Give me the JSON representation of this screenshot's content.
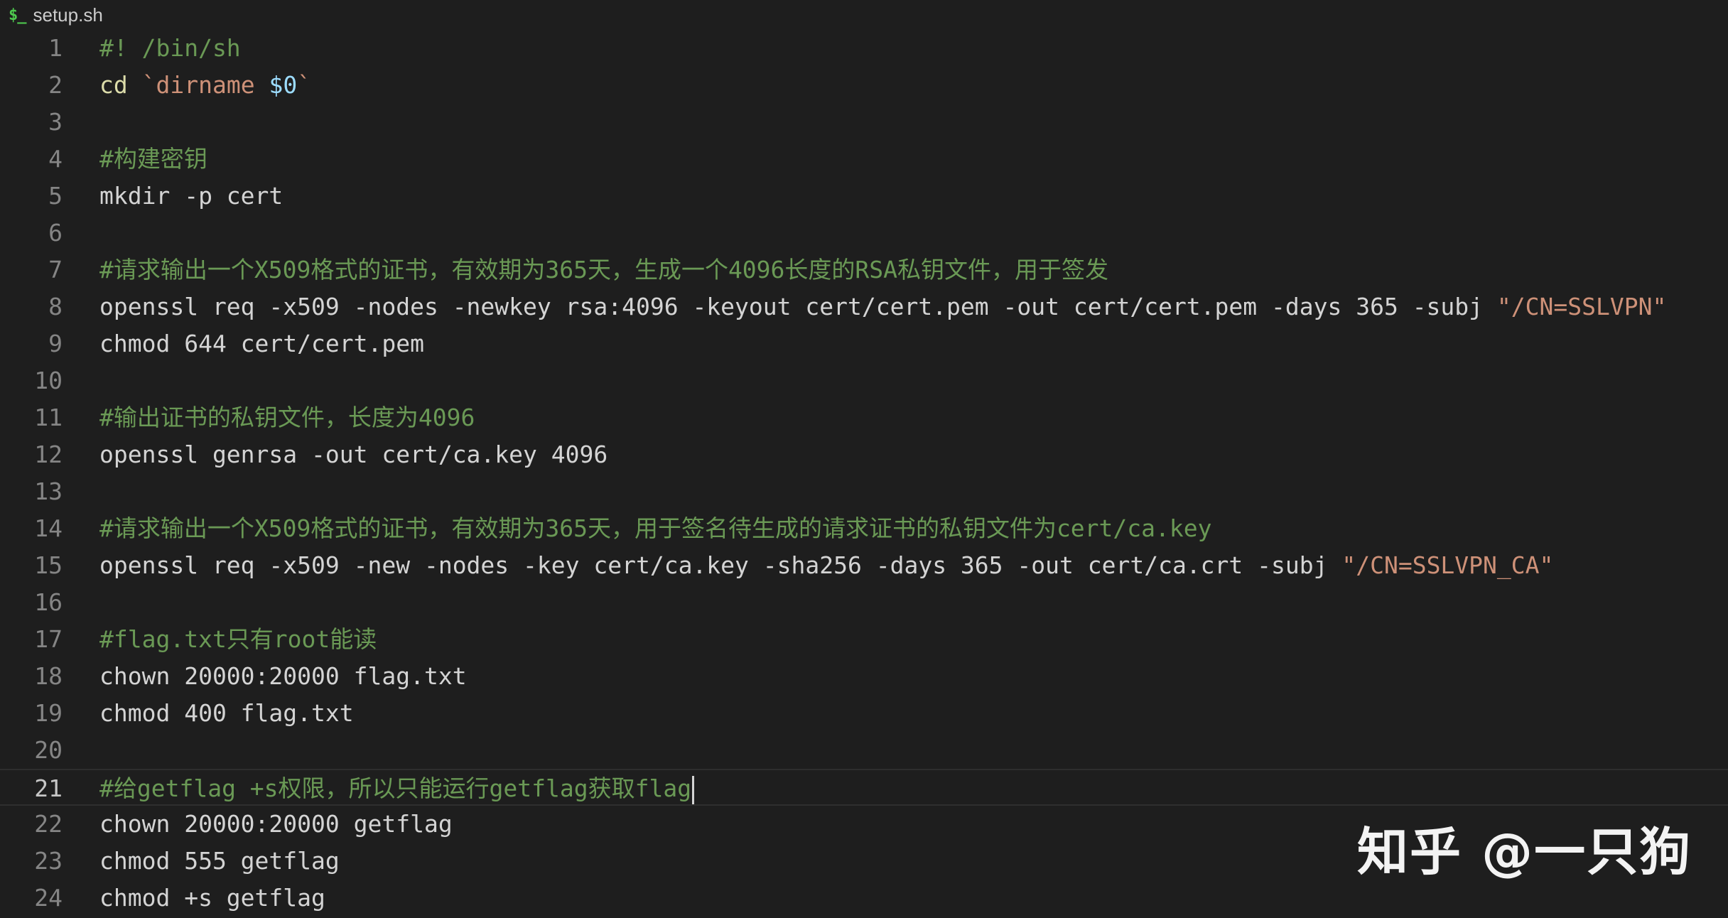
{
  "tab": {
    "icon": "$_",
    "icon_name": "terminal-shell-icon",
    "filename": "setup.sh"
  },
  "colors": {
    "background": "#1e1e1e",
    "comment": "#6a9955",
    "builtin": "#dcdcaa",
    "string": "#ce9178",
    "variable": "#9cdcfe",
    "text": "#d4d4d4",
    "line_number": "#858585"
  },
  "editor": {
    "current_line": 21,
    "lines": [
      {
        "n": "1",
        "tokens": [
          {
            "t": "#! /bin/sh",
            "c": "comment"
          }
        ]
      },
      {
        "n": "2",
        "tokens": [
          {
            "t": "cd",
            "c": "builtin"
          },
          {
            "t": " `",
            "c": "string"
          },
          {
            "t": "dirname",
            "c": "string"
          },
          {
            "t": " ",
            "c": "plain"
          },
          {
            "t": "$0",
            "c": "variable"
          },
          {
            "t": "`",
            "c": "string"
          }
        ]
      },
      {
        "n": "3",
        "tokens": []
      },
      {
        "n": "4",
        "tokens": [
          {
            "t": "#构建密钥",
            "c": "comment"
          }
        ]
      },
      {
        "n": "5",
        "tokens": [
          {
            "t": "mkdir -p cert",
            "c": "plain"
          }
        ]
      },
      {
        "n": "6",
        "tokens": []
      },
      {
        "n": "7",
        "tokens": [
          {
            "t": "#请求输出一个X509格式的证书，有效期为365天，生成一个4096长度的RSA私钥文件，用于签发",
            "c": "comment"
          }
        ]
      },
      {
        "n": "8",
        "tokens": [
          {
            "t": "openssl req -x509 -nodes -newkey rsa:4096 -keyout cert/cert.pem -out cert/cert.pem -days 365 -subj ",
            "c": "plain"
          },
          {
            "t": "\"/CN=SSLVPN\"",
            "c": "string"
          }
        ]
      },
      {
        "n": "9",
        "tokens": [
          {
            "t": "chmod 644 cert/cert.pem",
            "c": "plain"
          }
        ]
      },
      {
        "n": "10",
        "tokens": []
      },
      {
        "n": "11",
        "tokens": [
          {
            "t": "#输出证书的私钥文件，长度为4096",
            "c": "comment"
          }
        ]
      },
      {
        "n": "12",
        "tokens": [
          {
            "t": "openssl genrsa -out cert/ca.key 4096",
            "c": "plain"
          }
        ]
      },
      {
        "n": "13",
        "tokens": []
      },
      {
        "n": "14",
        "tokens": [
          {
            "t": "#请求输出一个X509格式的证书，有效期为365天，用于签名待生成的请求证书的私钥文件为cert/ca.key",
            "c": "comment"
          }
        ]
      },
      {
        "n": "15",
        "tokens": [
          {
            "t": "openssl req -x509 -new -nodes -key cert/ca.key -sha256 -days 365 -out cert/ca.crt -subj ",
            "c": "plain"
          },
          {
            "t": "\"/CN=SSLVPN_CA\"",
            "c": "string"
          }
        ]
      },
      {
        "n": "16",
        "tokens": []
      },
      {
        "n": "17",
        "tokens": [
          {
            "t": "#flag.txt只有root能读",
            "c": "comment"
          }
        ]
      },
      {
        "n": "18",
        "tokens": [
          {
            "t": "chown 20000:20000 flag.txt",
            "c": "plain"
          }
        ]
      },
      {
        "n": "19",
        "tokens": [
          {
            "t": "chmod 400 flag.txt",
            "c": "plain"
          }
        ]
      },
      {
        "n": "20",
        "tokens": []
      },
      {
        "n": "21",
        "tokens": [
          {
            "t": "#给getflag +s权限，所以只能运行getflag获取flag",
            "c": "comment"
          }
        ]
      },
      {
        "n": "22",
        "tokens": [
          {
            "t": "chown 20000:20000 getflag",
            "c": "plain"
          }
        ]
      },
      {
        "n": "23",
        "tokens": [
          {
            "t": "chmod 555 getflag",
            "c": "plain"
          }
        ]
      },
      {
        "n": "24",
        "tokens": [
          {
            "t": "chmod +s getflag",
            "c": "plain"
          }
        ]
      }
    ]
  },
  "watermark": {
    "text": "知乎 @一只狗"
  }
}
